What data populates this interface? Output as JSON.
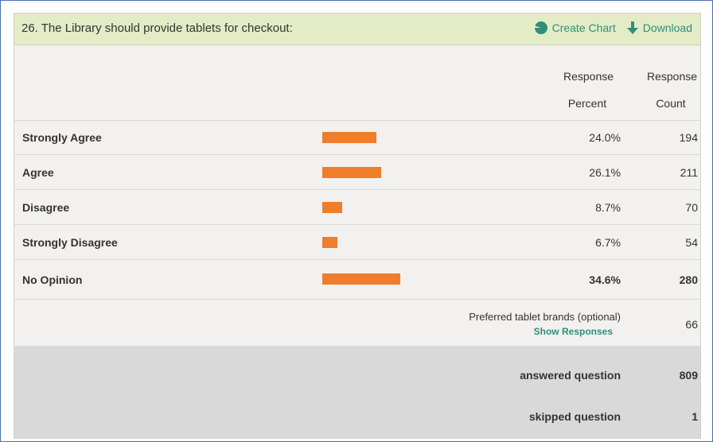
{
  "question": {
    "title": "26. The Library should provide tablets for checkout:",
    "create_chart": "Create Chart",
    "download": "Download"
  },
  "columns": {
    "percent_line1": "Response",
    "percent_line2": "Percent",
    "count_line1": "Response",
    "count_line2": "Count"
  },
  "rows": [
    {
      "label": "Strongly Agree",
      "percent": "24.0%",
      "count": "194",
      "value": 24.0
    },
    {
      "label": "Agree",
      "percent": "26.1%",
      "count": "211",
      "value": 26.1
    },
    {
      "label": "Disagree",
      "percent": "8.7%",
      "count": "70",
      "value": 8.7
    },
    {
      "label": "Strongly Disagree",
      "percent": "6.7%",
      "count": "54",
      "value": 6.7
    },
    {
      "label": "No Opinion",
      "percent": "34.6%",
      "count": "280",
      "value": 34.6
    }
  ],
  "other": {
    "text": "Preferred tablet brands (optional)",
    "link": "Show Responses",
    "count": "66"
  },
  "summary": {
    "answered_label": "answered question",
    "answered_value": "809",
    "skipped_label": "skipped question",
    "skipped_value": "1"
  },
  "colors": {
    "bar": "#ef7d2a",
    "accent": "#2f8f7a",
    "header_bg": "#e3ecc7"
  }
}
